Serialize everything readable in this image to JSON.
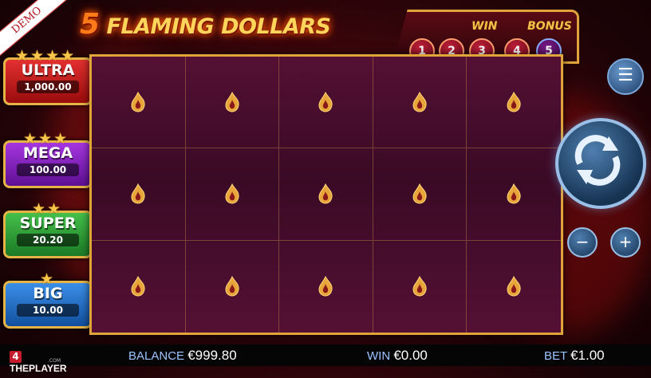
{
  "demo_label": "DEMO",
  "game": {
    "title_number": "5",
    "title_text": "FLAMING DOLLARS"
  },
  "win_bonus": {
    "win_label": "WIN",
    "bonus_label": "BONUS",
    "steps": [
      "1",
      "2",
      "3",
      "4",
      "5"
    ]
  },
  "jackpots": [
    {
      "name": "ULTRA",
      "value": "1,000.00",
      "stars": "★★★★",
      "color": "#d01e1e"
    },
    {
      "name": "MEGA",
      "value": "100.00",
      "stars": "★★★",
      "color": "#8a1fc7"
    },
    {
      "name": "SUPER",
      "value": "20.20",
      "stars": "★★",
      "color": "#2fa03a"
    },
    {
      "name": "BIG",
      "value": "10.00",
      "stars": "★",
      "color": "#1f6fd8"
    }
  ],
  "grid": {
    "rows": 3,
    "cols": 5,
    "symbol": "flame-icon"
  },
  "controls": {
    "menu_icon": "☰",
    "spin_icon": "spin-icon",
    "minus": "−",
    "plus": "+"
  },
  "footer": {
    "brand_num": "4",
    "brand_name": "THEPLAYER",
    "brand_sub": ".COM",
    "balance_label": "BALANCE",
    "balance_value": "€999.80",
    "win_label": "WIN",
    "win_value": "€0.00",
    "bet_label": "BET",
    "bet_value": "€1.00"
  },
  "colors": {
    "gold": "#e0a43a",
    "grid_bg": "#4a0c2d",
    "blue": "#9bc4ff"
  }
}
